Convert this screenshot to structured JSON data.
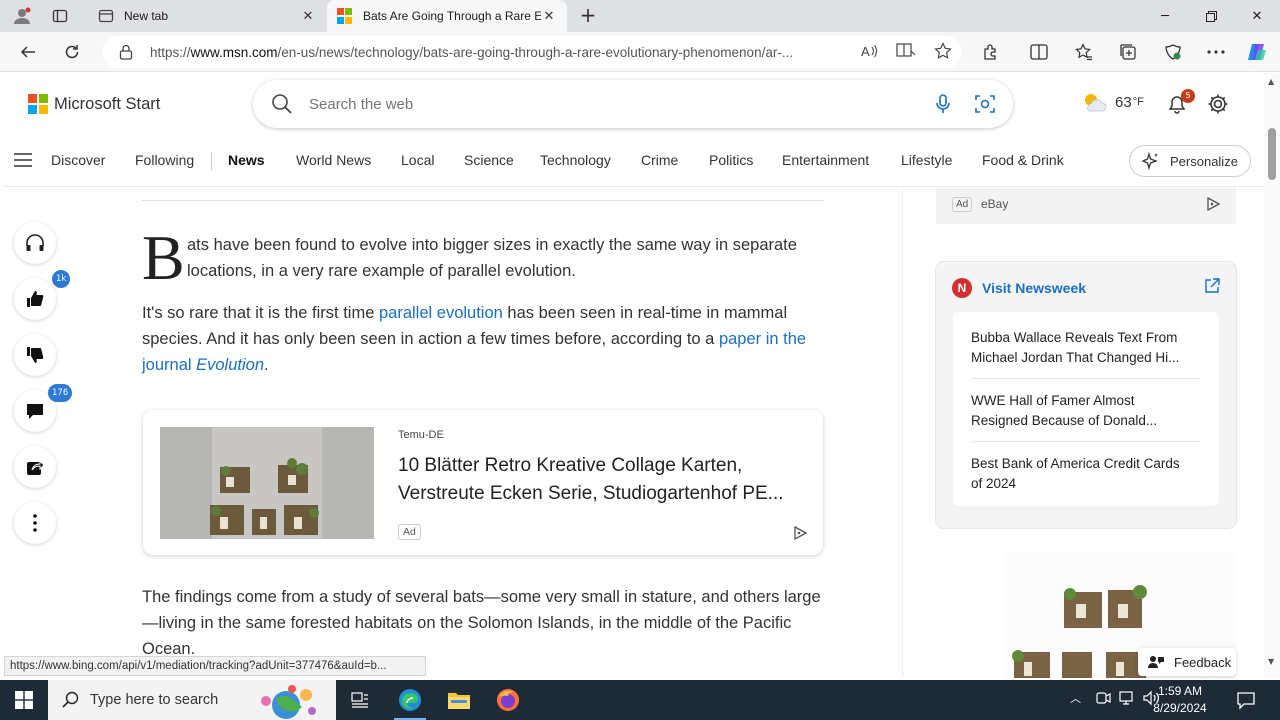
{
  "browser": {
    "tabs": [
      {
        "title": "New tab",
        "active": false
      },
      {
        "title": "Bats Are Going Through a Rare Ev",
        "active": true
      }
    ],
    "url_prefix": "https://",
    "url_host": "www.msn.com",
    "url_path": "/en-us/news/technology/bats-are-going-through-a-rare-evolutionary-phenomenon/ar-..."
  },
  "header": {
    "logo_text": "Microsoft Start",
    "search_placeholder": "Search the web",
    "weather_temp": "63",
    "weather_unit": "°F",
    "notifications_count": "5"
  },
  "nav": {
    "items": [
      "Discover",
      "Following",
      "News",
      "World News",
      "Local",
      "Science",
      "Technology",
      "Crime",
      "Politics",
      "Entertainment",
      "Lifestyle",
      "Food & Drink"
    ],
    "personalize": "Personalize"
  },
  "rail": {
    "likes_badge": "1k",
    "comments_badge": "176"
  },
  "article": {
    "dropcap": "B",
    "intro": "ats have been found to evolve into bigger sizes in exactly the same way in separate locations, in a very rare example of parallel evolution.",
    "p2_a": "It's so rare that it is the first time ",
    "p2_link1": "parallel evolution",
    "p2_b": " has been seen in real-time in mammal species. And it has only been seen in action a few times before, according to a ",
    "p2_link2": "paper in the journal ",
    "p2_link2_italic": "Evolution",
    "p2_c": ".",
    "p3": "The findings come from a study of several bats—some very small in stature, and others large—living in the same forested habitats on the Solomon Islands, in the middle of the Pacific Ocean."
  },
  "ad": {
    "source": "Temu-DE",
    "title_line1": "10 Blätter Retro Kreative Collage Karten,",
    "title_line2": "Verstreute Ecken Serie, Studiogartenhof PE...",
    "tag": "Ad"
  },
  "sidebar": {
    "ebay_tag": "Ad",
    "ebay_name": "eBay",
    "newsweek_title": "Visit Newsweek",
    "newsweek_logo": "N",
    "stories": [
      {
        "line1": "Bubba Wallace Reveals Text From",
        "line2": "Michael Jordan That Changed Hi..."
      },
      {
        "line1": "WWE Hall of Famer Almost",
        "line2": "Resigned Because of Donald..."
      },
      {
        "line1": "Best Bank of America Credit Cards",
        "line2": "of 2024"
      }
    ],
    "feedback": "Feedback"
  },
  "status_url": "https://www.bing.com/api/v1/mediation/tracking?adUnit=377476&auId=b...",
  "taskbar": {
    "search_placeholder": "Type here to search",
    "time": "1:59 AM",
    "date": "8/29/2024"
  },
  "colors": {
    "accent": "#1a6fc2",
    "badge_blue": "#2b7bd6",
    "badge_red": "#c43e1c",
    "taskbar": "#1f2a37"
  }
}
